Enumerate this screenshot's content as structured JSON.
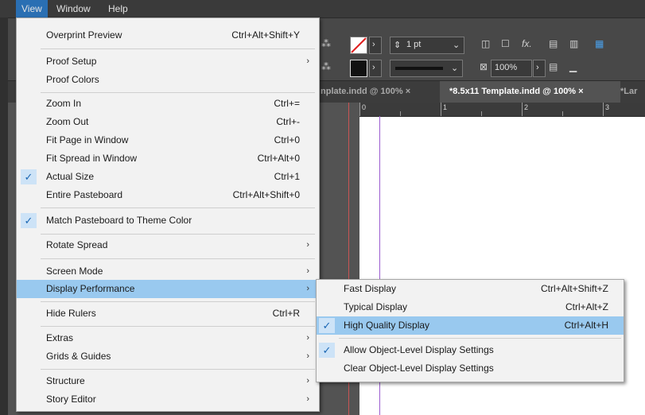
{
  "menubar": {
    "view": "View",
    "window": "Window",
    "help": "Help"
  },
  "control_panel": {
    "stroke_weight": "1 pt",
    "opacity": "100%",
    "fx": "fx."
  },
  "tabs": [
    {
      "label": "nplate.indd @ 100% ×"
    },
    {
      "label": "*8.5x11 Template.indd @ 100% ×"
    },
    {
      "label": "*Lar"
    }
  ],
  "ruler": {
    "labels": [
      "0",
      "1",
      "2",
      "3"
    ]
  },
  "view_menu": {
    "items": [
      {
        "label": "Overprint Preview",
        "shortcut": "Ctrl+Alt+Shift+Y"
      },
      {
        "label": "Proof Setup",
        "arrow": "›"
      },
      {
        "label": "Proof Colors"
      },
      {
        "label": "Zoom In",
        "shortcut": "Ctrl+="
      },
      {
        "label": "Zoom Out",
        "shortcut": "Ctrl+-"
      },
      {
        "label": "Fit Page in Window",
        "shortcut": "Ctrl+0"
      },
      {
        "label": "Fit Spread in Window",
        "shortcut": "Ctrl+Alt+0"
      },
      {
        "label": "Actual Size",
        "shortcut": "Ctrl+1",
        "checked": "✓"
      },
      {
        "label": "Entire Pasteboard",
        "shortcut": "Ctrl+Alt+Shift+0"
      },
      {
        "label": "Match Pasteboard to Theme Color",
        "checked": "✓"
      },
      {
        "label": "Rotate Spread",
        "arrow": "›"
      },
      {
        "label": "Screen Mode",
        "arrow": "›"
      },
      {
        "label": "Display Performance",
        "arrow": "›"
      },
      {
        "label": "Hide Rulers",
        "shortcut": "Ctrl+R"
      },
      {
        "label": "Extras",
        "arrow": "›"
      },
      {
        "label": "Grids & Guides",
        "arrow": "›"
      },
      {
        "label": "Structure",
        "arrow": "›"
      },
      {
        "label": "Story Editor",
        "arrow": "›"
      }
    ]
  },
  "submenu": {
    "items": [
      {
        "label": "Fast Display",
        "shortcut": "Ctrl+Alt+Shift+Z"
      },
      {
        "label": "Typical Display",
        "shortcut": "Ctrl+Alt+Z"
      },
      {
        "label": "High Quality Display",
        "shortcut": "Ctrl+Alt+H",
        "checked": "✓"
      },
      {
        "label": "Allow Object-Level Display Settings",
        "checked": "✓"
      },
      {
        "label": "Clear Object-Level Display Settings"
      }
    ]
  }
}
